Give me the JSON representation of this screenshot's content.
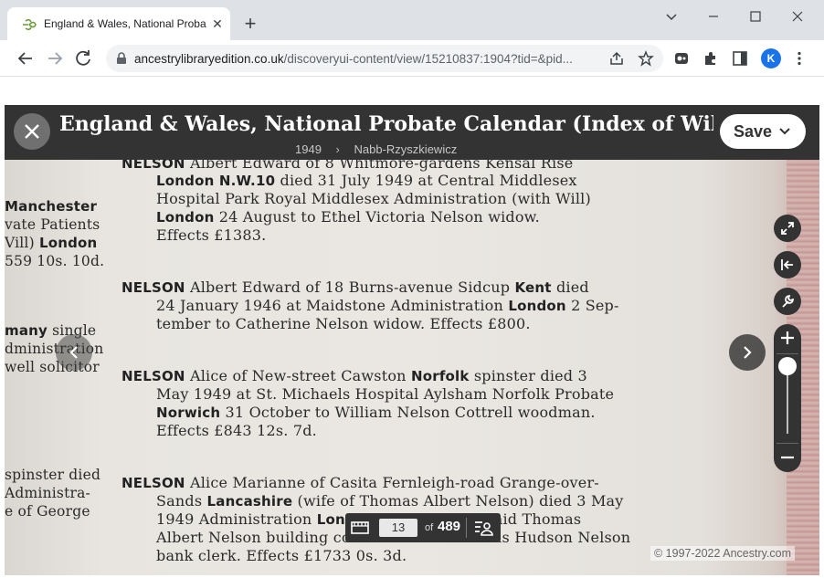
{
  "browser": {
    "tab_title": "England & Wales, National Probate Calendar (Index of Wills and...",
    "tab_close": "✕",
    "new_tab": "+",
    "url_host": "ancestrylibraryedition.co.uk",
    "url_path": "/discoveryui-content/view/15210837:1904?tid=&pid...",
    "profile_initial": "K",
    "icons": [
      "ancestry-leaf-icon",
      "back-arrow-icon",
      "forward-arrow-icon",
      "reload-icon",
      "lock-icon",
      "share-icon",
      "star-icon",
      "extension-icon",
      "puzzle-icon",
      "sidepanel-icon",
      "kebab-menu-icon"
    ]
  },
  "viewer": {
    "title": "England & Wales, National Probate Calendar (Index of Wills and...",
    "breadcrumb": [
      "1949",
      "Nabb-Rzyszkiewicz"
    ],
    "breadcrumb_sep": "›",
    "save_label": "Save",
    "page_number": "13",
    "of_label": "of",
    "total_pages": "489",
    "copyright": "© 1997-2022 Ancestry.com",
    "zoom_level": 0.95
  },
  "record_lines": [
    {
      "bold": "NELSON",
      "text": " Albert Edward of 8 Whitmore-gardens Kensal Rise"
    },
    {
      "bold": "London  N.W.10",
      "text": " died 31 July 1949 at Central Middlesex"
    },
    {
      "text": "Hospital Park Royal Middlesex  Administration (with Will)"
    },
    {
      "bold": "London",
      "text": " 24 August to Ethel Victoria Nelson widow."
    },
    {
      "text": "Effects £1383."
    },
    {
      "bold": "NELSON",
      "text": " Albert Edward of 18 Burns-avenue Sidcup ",
      "bold2": "Kent",
      "text2": " died"
    },
    {
      "text": "24 January 1946 at Maidstone Administration ",
      "bold": "London",
      "text2": " 2 Sep-"
    },
    {
      "text": "tember to Catherine Nelson widow.   Effects £800."
    },
    {
      "bold": "NELSON",
      "text": " Alice of New-street Cawston ",
      "bold2": "Norfolk",
      "text2": " spinster died 3"
    },
    {
      "text": "May 1949 at St. Michaels Hospital Aylsham Norfolk Probate"
    },
    {
      "bold": "Norwich",
      "text": " 31 October to William Nelson Cottrell woodman."
    },
    {
      "text": "Effects £843 12s. 7d."
    },
    {
      "bold": "NELSON",
      "text": " Alice Marianne of Casita Fernleigh-road Grange-over-"
    },
    {
      "text": "Sands ",
      "bold": "Lancashire",
      "text2": " (wife of Thomas Albert Nelson) died 3 May"
    },
    {
      "text": "1949 Administration  ",
      "bold": "London",
      "text2": " 21 July to the said Thomas"
    },
    {
      "text": "Albert Nelson building contractor and Thomas Hudson Nelson"
    },
    {
      "text": "bank clerk.   Effects £1733 0s. 3d."
    }
  ],
  "left_column": [
    {
      "bold": "Manchester"
    },
    {
      "text": "vate Patients"
    },
    {
      "text": "Vill) ",
      "bold": "London"
    },
    {
      "text": "559 10s. 10d."
    },
    {
      "bold": "many",
      "text": " single"
    },
    {
      "text": "dministration"
    },
    {
      "text": "well solicitor"
    },
    {
      "text": "spinster died"
    },
    {
      "text": "Administra-"
    },
    {
      "text": "e of George"
    }
  ]
}
